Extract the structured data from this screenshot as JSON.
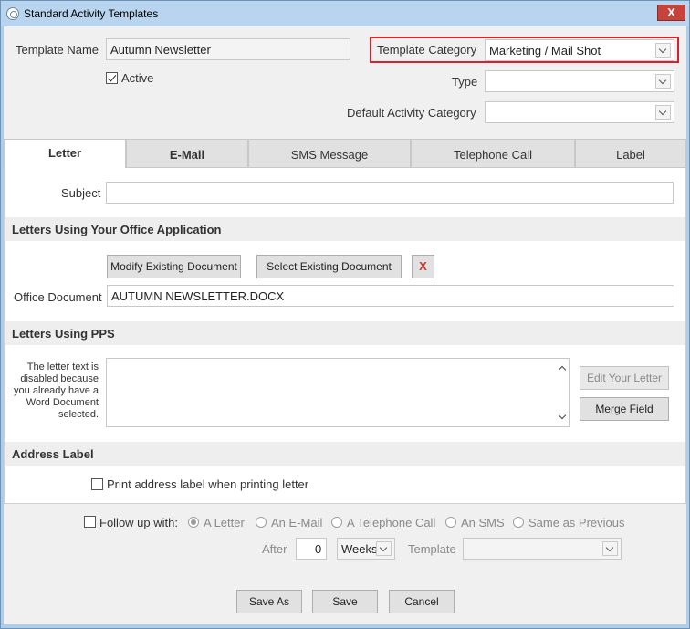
{
  "window": {
    "title": "Standard Activity Templates",
    "close_label": "X"
  },
  "header": {
    "template_name_label": "Template Name",
    "template_name_value": "Autumn Newsletter",
    "active_label": "Active",
    "active_checked": true,
    "template_category_label": "Template Category",
    "template_category_value": "Marketing / Mail Shot",
    "type_label": "Type",
    "type_value": "",
    "default_activity_category_label": "Default Activity Category",
    "default_activity_category_value": ""
  },
  "tabs": [
    {
      "label": "Letter",
      "active": true
    },
    {
      "label": "E-Mail",
      "active": false
    },
    {
      "label": "SMS Message",
      "active": false
    },
    {
      "label": "Telephone Call",
      "active": false
    },
    {
      "label": "Label",
      "active": false
    }
  ],
  "letter": {
    "subject_label": "Subject",
    "subject_value": "",
    "office_section_title": "Letters Using Your Office Application",
    "modify_button": "Modify Existing Document",
    "select_button": "Select Existing Document",
    "remove_button": "X",
    "office_document_label": "Office Document",
    "office_document_value": "AUTUMN NEWSLETTER.DOCX",
    "pps_section_title": "Letters Using PPS",
    "pps_note": "The letter text is disabled because you already have a Word Document selected.",
    "edit_letter_button": "Edit Your Letter",
    "merge_field_button": "Merge Field",
    "address_section_title": "Address Label",
    "print_address_label": "Print address label when printing letter"
  },
  "followup": {
    "label": "Follow up with:",
    "options": [
      "A Letter",
      "An E-Mail",
      "A Telephone Call",
      "An SMS",
      "Same as Previous"
    ],
    "selected_index": 0,
    "after_label": "After",
    "after_value": "0",
    "unit_value": "Weeks",
    "template_label": "Template",
    "template_value": ""
  },
  "footer": {
    "save_as": "Save As",
    "save": "Save",
    "cancel": "Cancel"
  },
  "colors": {
    "highlight": "#d6232b",
    "remove_x": "#d0342c",
    "titlebar": "#b9d4ee"
  }
}
